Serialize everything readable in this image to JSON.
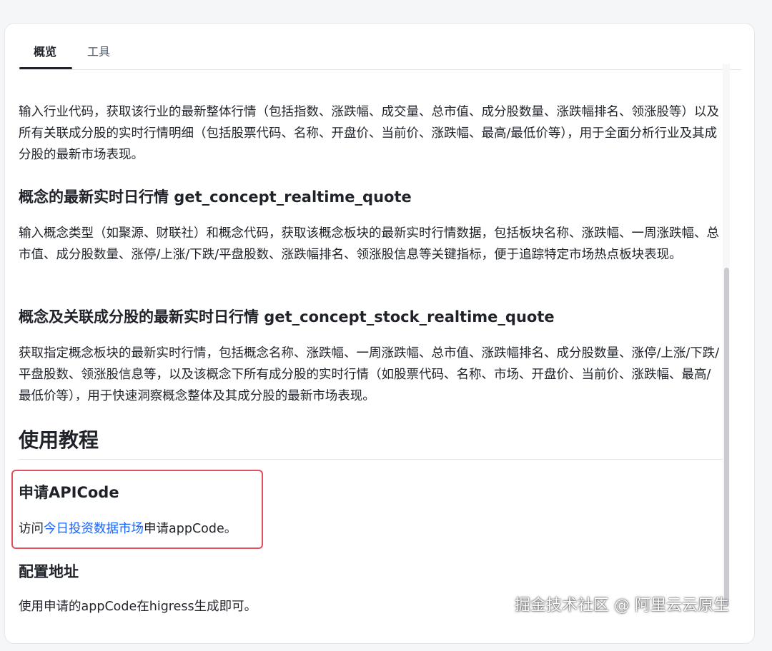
{
  "tabs": [
    {
      "label": "概览",
      "active": true
    },
    {
      "label": "工具",
      "active": false
    }
  ],
  "doc": {
    "intro": "输入行业代码，获取该行业的最新整体行情（包括指数、涨跌幅、成交量、总市值、成分股数量、涨跌幅排名、领涨股等）以及所有关联成分股的实时行情明细（包括股票代码、名称、开盘价、当前价、涨跌幅、最高/最低价等），用于全面分析行业及其成分股的最新市场表现。",
    "section1": {
      "title": "概念的最新实时日行情 get_concept_realtime_quote",
      "desc": "输入概念类型（如聚源、财联社）和概念代码，获取该概念板块的最新实时行情数据，包括板块名称、涨跌幅、一周涨跌幅、总市值、成分股数量、涨停/上涨/下跌/平盘股数、涨跌幅排名、领涨股信息等关键指标，便于追踪特定市场热点板块表现。"
    },
    "section2": {
      "title": "概念及关联成分股的最新实时日行情 get_concept_stock_realtime_quote",
      "desc": "获取指定概念板块的最新实时行情，包括概念名称、涨跌幅、一周涨跌幅、总市值、涨跌幅排名、成分股数量、涨停/上涨/下跌/平盘股数、领涨股信息等，以及该概念下所有成分股的实时行情（如股票代码、名称、市场、开盘价、当前价、涨跌幅、最高/最低价等），用于快速洞察概念整体及其成分股的最新市场表现。"
    },
    "tutorial": {
      "title": "使用教程",
      "apply": {
        "title": "申请APICode",
        "prefix": "访问",
        "link": "今日投资数据市场",
        "suffix": "申请appCode。"
      },
      "config": {
        "title": "配置地址",
        "text": "使用申请的appCode在higress生成即可。"
      }
    }
  },
  "watermark": "掘金技术社区 @ 阿里云云原生",
  "colors": {
    "link": "#1664ff",
    "highlight_border": "#e2505b",
    "text": "#1f2329"
  }
}
